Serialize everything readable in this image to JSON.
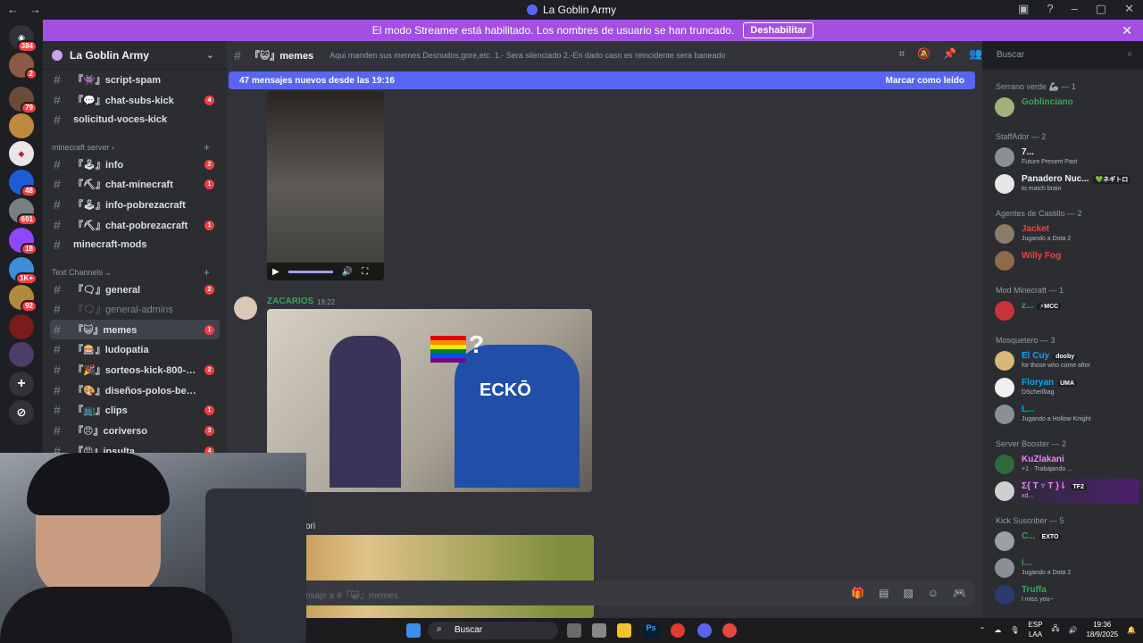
{
  "titlebar": {
    "title": "La Goblin Army"
  },
  "banner": {
    "text": "El modo Streamer está habilitado. Los nombres de usuario se han truncado.",
    "button": "Deshabilitar"
  },
  "rail": {
    "badges": [
      "384",
      "2",
      "79",
      "48",
      "691",
      "18",
      "1K+",
      "92"
    ]
  },
  "sidebar": {
    "server_name": "La Goblin Army",
    "channels_top": [
      {
        "name": "『👾』script-spam",
        "badge": ""
      },
      {
        "name": "『💬』chat-subs-kick",
        "badge": "4"
      },
      {
        "name": "solicitud-voces-kick",
        "badge": ""
      }
    ],
    "category_minecraft": "minecraft server",
    "channels_minecraft": [
      {
        "name": "『🕹』info",
        "badge": "2"
      },
      {
        "name": "『⛏』chat-minecraft",
        "badge": "1"
      },
      {
        "name": "『🕹』info-pobrezacraft",
        "badge": ""
      },
      {
        "name": "『⛏』chat-pobrezacraft",
        "badge": "1"
      },
      {
        "name": "minecraft-mods",
        "badge": ""
      }
    ],
    "category_text": "Text Channels",
    "channels_text": [
      {
        "name": "『🗨』general",
        "badge": "2"
      },
      {
        "name": "『🗨』general-admins",
        "badge": ""
      },
      {
        "name": "『😺』memes",
        "badge": "1"
      },
      {
        "name": "『🎰』ludopatia",
        "badge": ""
      },
      {
        "name": "『🎉』sorteos-kick-800-s...",
        "badge": "2"
      },
      {
        "name": "『🎨』diseños-polos-beluga-ar...",
        "badge": ""
      },
      {
        "name": "『📺』clips",
        "badge": "1"
      },
      {
        "name": "『😠』coriverso",
        "badge": "3"
      },
      {
        "name": "『😡』insulta",
        "badge": "4"
      }
    ]
  },
  "channel": {
    "name": "『😺』memes",
    "topic": "Aqui manden sus memes.Desnudos,gore,etc. 1.- Sera silenciado 2.-En dado caso es reincidente sera baneado",
    "search_placeholder": "Buscar",
    "new_messages": "47 mensajes nuevos desde las 19:16",
    "mark_read": "Marcar como leído",
    "composer_placeholder": "nsaje a #『😺』memes"
  },
  "messages": [
    {
      "author": "ZACARIOS",
      "time": "19:22"
    },
    {
      "author": "",
      "partial_text": "ori"
    }
  ],
  "members": {
    "groups": [
      {
        "label": "Serrano verde 🦾 — 1",
        "members": [
          {
            "name": "Goblinciano",
            "color": "#3ba55c",
            "status": ""
          }
        ]
      },
      {
        "label": "StaffAdor — 2",
        "members": [
          {
            "name": "7...",
            "color": "#f2f3f5",
            "status": "Future Present Past"
          },
          {
            "name": "Panadero Nuc...",
            "color": "#f2f3f5",
            "status": "to match brain",
            "tag": "💚ネギトロ"
          }
        ]
      },
      {
        "label": "Agentes de Castillo — 2",
        "members": [
          {
            "name": "Jacket",
            "color": "#ed4245",
            "status": "Jugando a Dota 2"
          },
          {
            "name": "Willy Fog",
            "color": "#ed4245",
            "status": ""
          }
        ]
      },
      {
        "label": "Mod Minecraft — 1",
        "members": [
          {
            "name": "z...",
            "color": "#3ba55c",
            "status": "",
            "tag": "⚡MCC"
          }
        ]
      },
      {
        "label": "Mosquetero — 3",
        "members": [
          {
            "name": "El Cuy",
            "color": "#00a8fc",
            "status": "for those who come after",
            "tag": "dooby"
          },
          {
            "name": "Floryan",
            "color": "#00a8fc",
            "status": "DScheißtag",
            "tag": "UMA"
          },
          {
            "name": "L...",
            "color": "#00a8fc",
            "status": "Jugando a Hollow Knight"
          }
        ]
      },
      {
        "label": "Server Booster — 2",
        "members": [
          {
            "name": "KuZlakani",
            "color": "#f47fff",
            "status": "+1 · Trabajando ...",
            "tag": ""
          },
          {
            "name": "Σ{ T ▿ T }⇂",
            "color": "#f47fff",
            "status": "xd...",
            "tag": "TF2"
          }
        ]
      },
      {
        "label": "Kick Suscriber — 5",
        "members": [
          {
            "name": "C...",
            "color": "#3ba55c",
            "status": "",
            "tag": "EXTO"
          },
          {
            "name": "i...",
            "color": "#3ba55c",
            "status": "Jugando a Dota 2"
          },
          {
            "name": "Truffa",
            "color": "#3ba55c",
            "status": "I miss you~"
          }
        ]
      }
    ]
  },
  "taskbar": {
    "search": "Buscar",
    "lang1": "ESP",
    "lang2": "LAA",
    "time": "19:36",
    "date": "18/9/2025"
  }
}
